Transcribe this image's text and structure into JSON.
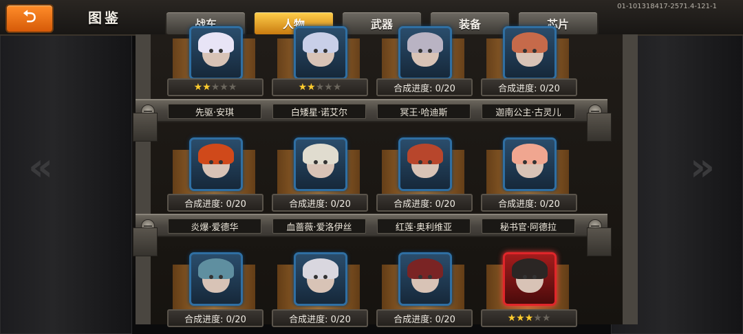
{
  "header": {
    "back_label": "⮌",
    "title": "图鉴",
    "version": "01-101318417-2571.4-121-1"
  },
  "tabs": [
    {
      "label": "战车",
      "active": false
    },
    {
      "label": "人物",
      "active": true
    },
    {
      "label": "武器",
      "active": false
    },
    {
      "label": "装备",
      "active": false
    },
    {
      "label": "芯片",
      "active": false
    }
  ],
  "shelves": [
    {
      "cards": [
        {
          "name": "先驱·安琪",
          "status_type": "stars",
          "stars": 2,
          "max_stars": 5,
          "hair": "#e8e4f6"
        },
        {
          "name": "白矮星·诺艾尔",
          "status_type": "stars",
          "stars": 2,
          "max_stars": 5,
          "hair": "#c9cfe8"
        },
        {
          "name": "冥王·哈迪斯",
          "status_type": "progress",
          "progress": "合成进度: 0/20",
          "hair": "#b9b3c3"
        },
        {
          "name": "迦南公主·古灵儿",
          "status_type": "progress",
          "progress": "合成进度: 0/20",
          "hair": "#c66a4a"
        }
      ]
    },
    {
      "cards": [
        {
          "name": "炎爆·爱德华",
          "status_type": "progress",
          "progress": "合成进度: 0/20",
          "hair": "#d0491a"
        },
        {
          "name": "血蔷薇·爱洛伊丝",
          "status_type": "progress",
          "progress": "合成进度: 0/20",
          "hair": "#e0dccf"
        },
        {
          "name": "红莲·奥利维亚",
          "status_type": "progress",
          "progress": "合成进度: 0/20",
          "hair": "#b8462c"
        },
        {
          "name": "秘书官·阿德拉",
          "status_type": "progress",
          "progress": "合成进度: 0/20",
          "hair": "#f0a690"
        }
      ]
    },
    {
      "cards": [
        {
          "name": "",
          "status_type": "progress",
          "progress": "合成进度: 0/20",
          "hair": "#5f8fa0"
        },
        {
          "name": "",
          "status_type": "progress",
          "progress": "合成进度: 0/20",
          "hair": "#d9d7df"
        },
        {
          "name": "",
          "status_type": "progress",
          "progress": "合成进度: 0/20",
          "hair": "#7a2424"
        },
        {
          "name": "",
          "status_type": "stars",
          "stars": 3,
          "max_stars": 5,
          "rare": true,
          "hair": "#2b2624"
        }
      ]
    }
  ]
}
